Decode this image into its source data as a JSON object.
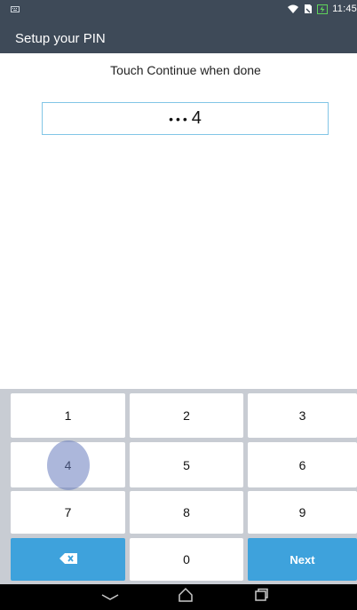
{
  "status_bar": {
    "time": "11:45",
    "notification_icon": "keyboard-icon",
    "wifi_icon": "wifi-icon",
    "sim_icon": "sim-icon",
    "battery_icon": "battery-charging-icon"
  },
  "app_bar": {
    "title": "Setup your PIN"
  },
  "instruction": "Touch Continue when done",
  "pin_field": {
    "masked": "•••",
    "last_digit": "4"
  },
  "keypad": {
    "keys": [
      "1",
      "2",
      "3",
      "4",
      "5",
      "6",
      "7",
      "8",
      "9"
    ],
    "zero": "0",
    "next_label": "Next",
    "delete_icon": "backspace-icon"
  },
  "nav_bar": {
    "back_icon": "back-chevron-icon",
    "home_icon": "home-icon",
    "recents_icon": "recents-icon"
  }
}
